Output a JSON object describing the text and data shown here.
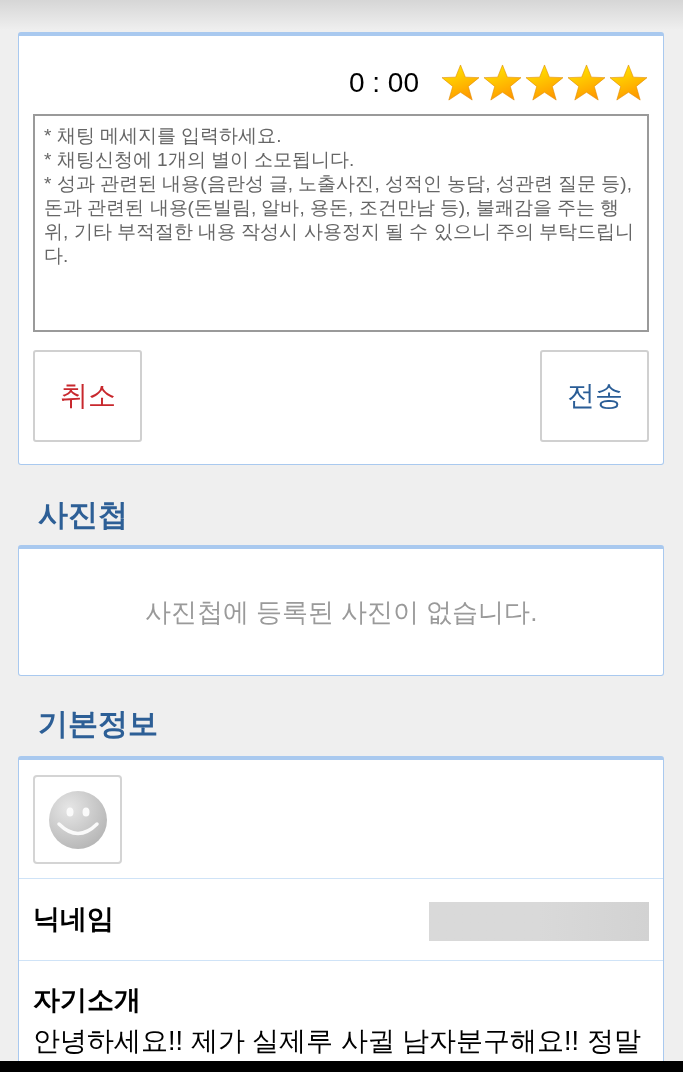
{
  "chat": {
    "timer": "0 : 00",
    "stars": 5,
    "message": {
      "placeholder": "* 채팅 메세지를 입력하세요.\n* 채팅신청에 1개의 별이 소모됩니다.\n* 성과 관련된 내용(음란성 글, 노출사진, 성적인 농담, 성관련 질문 등), 돈과 관련된 내용(돈빌림, 알바, 용돈, 조건만남 등), 불쾌감을 주는 행위, 기타 부적절한 내용 작성시 사용정지 될 수 있으니 주의 부탁드립니다."
    },
    "buttons": [
      {
        "kind": "cancel",
        "label": "취소"
      },
      {
        "kind": "send",
        "label": "전송"
      }
    ]
  },
  "album": {
    "title": "사진첩",
    "empty_text": "사진첩에 등록된 사진이 없습니다."
  },
  "profile": {
    "title": "기본정보",
    "nickname": {
      "label": "닉네임"
    },
    "intro": {
      "label": "자기소개",
      "text": "안녕하세요!! 제가 실제루 사귈 남자분구해요!! 정말"
    }
  }
}
